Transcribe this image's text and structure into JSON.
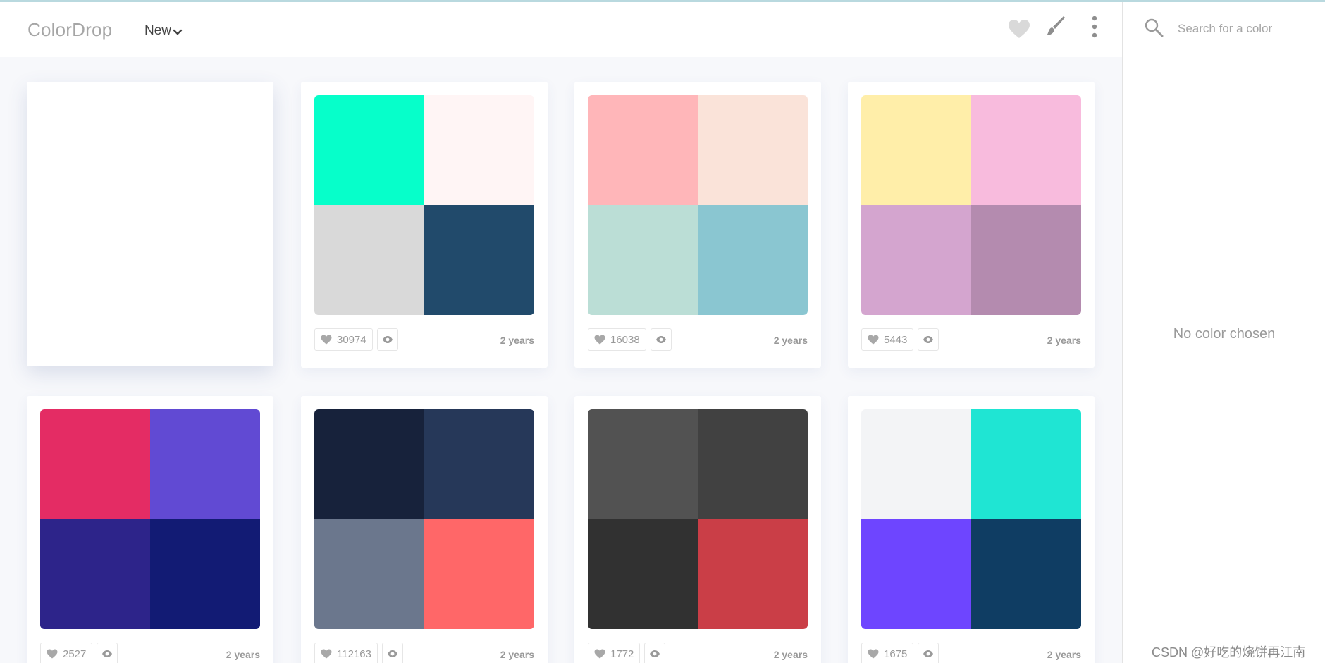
{
  "header": {
    "logo": "ColorDrop",
    "new_menu_label": "New",
    "icons": {
      "likes": "heart-icon",
      "create": "brush-icon",
      "more": "more-vertical-icon",
      "search": "search-icon"
    }
  },
  "sidebar": {
    "search_placeholder": "Search for a color",
    "empty_message": "No color chosen"
  },
  "palettes": [
    {
      "colors": [
        "#06ffca",
        "#fff5f5",
        "#d9d9d9",
        "#214a6b"
      ],
      "likes": "30974",
      "age": "2 years"
    },
    {
      "colors": [
        "#ffb6b9",
        "#fae3d9",
        "#bbded6",
        "#8ac6d1"
      ],
      "likes": "16038",
      "age": "2 years"
    },
    {
      "colors": [
        "#ffeea9",
        "#f8bbdd",
        "#d4a5cf",
        "#b48baf"
      ],
      "likes": "5443",
      "age": "2 years"
    },
    {
      "colors": [
        "#e42c64",
        "#614ad3",
        "#2d248a",
        "#121b74"
      ],
      "likes": "2527",
      "age": "2 years"
    },
    {
      "colors": [
        "#17223b",
        "#263859",
        "#6b778d",
        "#ff6768"
      ],
      "likes": "112163",
      "age": "2 years"
    },
    {
      "colors": [
        "#525252",
        "#414141",
        "#313131",
        "#ca3e47"
      ],
      "likes": "1772",
      "age": "2 years"
    },
    {
      "colors": [
        "#f3f4f6",
        "#1fe5d3",
        "#6e45ff",
        "#0f3d63"
      ],
      "likes": "1675",
      "age": "2 years"
    }
  ],
  "watermark": "CSDN @好吃的烧饼再江南"
}
